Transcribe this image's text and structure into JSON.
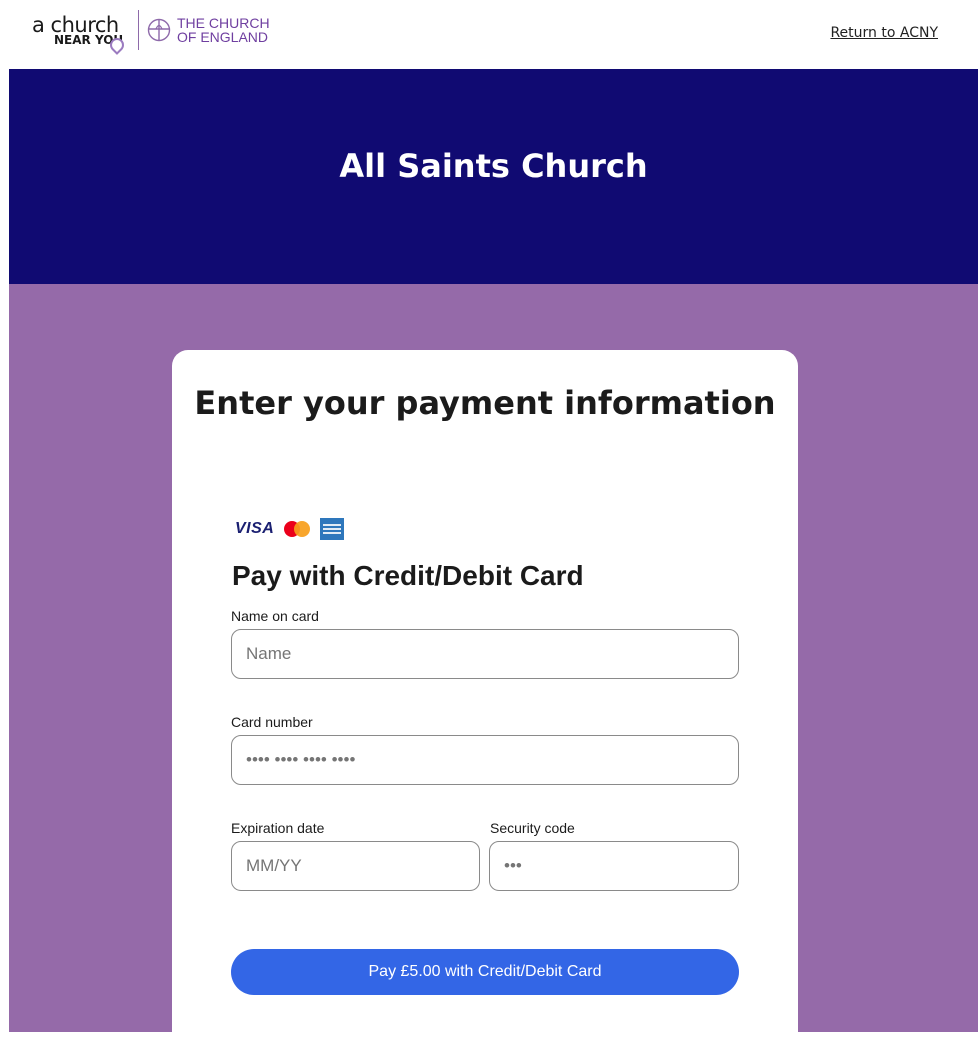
{
  "header": {
    "logo_acny_line1": "a church",
    "logo_acny_line2": "NEAR YOU",
    "logo_coe_line1": "THE CHURCH",
    "logo_coe_line2": "OF ENGLAND",
    "return_link": "Return to ACNY"
  },
  "hero": {
    "title": "All Saints Church"
  },
  "payment": {
    "title": "Enter your payment information",
    "brands": {
      "visa": "VISA"
    },
    "section_title": "Pay with Credit/Debit Card",
    "fields": {
      "name_label": "Name on card",
      "name_placeholder": "Name",
      "card_label": "Card number",
      "card_placeholder": "•••• •••• •••• ••••",
      "expiry_label": "Expiration date",
      "expiry_placeholder": "MM/YY",
      "cvc_label": "Security code",
      "cvc_placeholder": "•••"
    },
    "pay_button": "Pay £5.00 with Credit/Debit Card"
  },
  "colors": {
    "hero_background": "#100a72",
    "page_background": "#956aa9",
    "button": "#3366e6"
  }
}
